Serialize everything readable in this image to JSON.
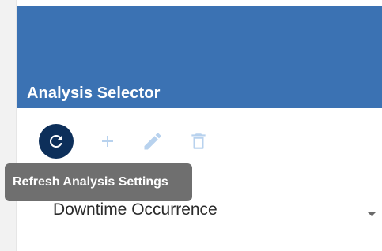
{
  "header": {
    "title": "Analysis Selector"
  },
  "toolbar": {
    "refresh_icon": "refresh-icon",
    "add_icon": "plus-icon",
    "edit_icon": "pencil-icon",
    "delete_icon": "trash-icon"
  },
  "tooltip": {
    "text": "Refresh Analysis Settings"
  },
  "analysis_select": {
    "value": "Downtime Occurrence"
  },
  "colors": {
    "header_bg": "#3b72b3",
    "refresh_bg": "#0d2f5a",
    "disabled_icon": "#b8d2ee",
    "tooltip_bg": "#6f6f6f"
  }
}
